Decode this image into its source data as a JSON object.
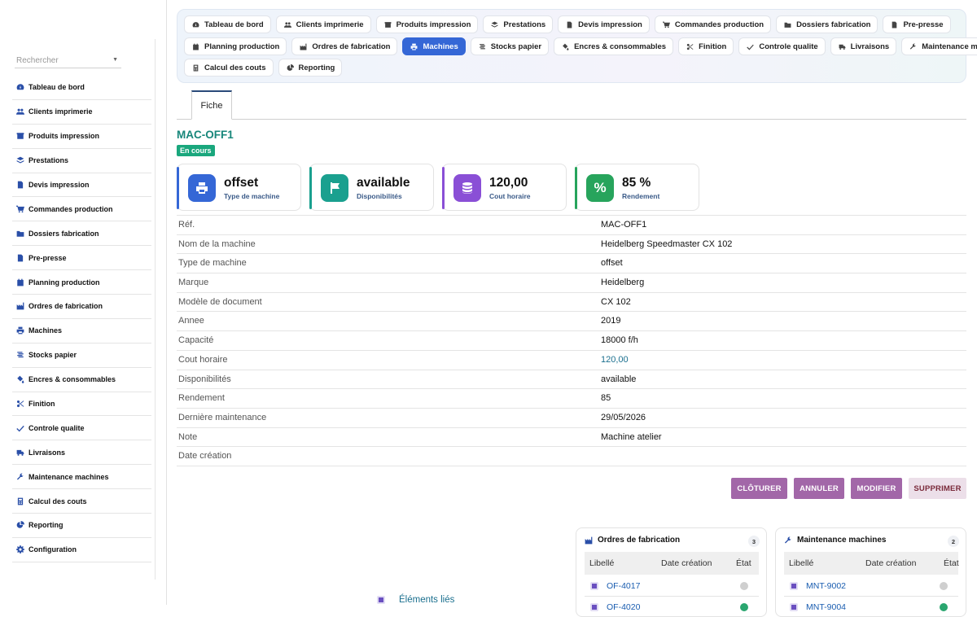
{
  "sidebar": {
    "search_placeholder": "Rechercher",
    "items": [
      {
        "label": "Tableau de bord",
        "icon": "dashboard-icon"
      },
      {
        "label": "Clients imprimerie",
        "icon": "users-icon"
      },
      {
        "label": "Produits impression",
        "icon": "box-icon"
      },
      {
        "label": "Prestations",
        "icon": "layers-icon"
      },
      {
        "label": "Devis impression",
        "icon": "file-icon"
      },
      {
        "label": "Commandes production",
        "icon": "cart-icon"
      },
      {
        "label": "Dossiers fabrication",
        "icon": "folder-icon"
      },
      {
        "label": "Pre-presse",
        "icon": "document-icon"
      },
      {
        "label": "Planning production",
        "icon": "calendar-icon"
      },
      {
        "label": "Ordres de fabrication",
        "icon": "industry-icon"
      },
      {
        "label": "Machines",
        "icon": "printer-icon"
      },
      {
        "label": "Stocks papier",
        "icon": "stack-icon"
      },
      {
        "label": "Encres & consommables",
        "icon": "fill-icon"
      },
      {
        "label": "Finition",
        "icon": "scissors-icon"
      },
      {
        "label": "Controle qualite",
        "icon": "check-icon"
      },
      {
        "label": "Livraisons",
        "icon": "truck-icon"
      },
      {
        "label": "Maintenance machines",
        "icon": "wrench-icon"
      },
      {
        "label": "Calcul des couts",
        "icon": "calculator-icon"
      },
      {
        "label": "Reporting",
        "icon": "chart-pie-icon"
      },
      {
        "label": "Configuration",
        "icon": "gear-icon"
      }
    ]
  },
  "topnav": {
    "row1": [
      "Tableau de bord",
      "Clients imprimerie",
      "Produits impression",
      "Prestations",
      "Devis impression",
      "Commandes production",
      "Dossiers fabrication",
      "Pre-presse"
    ],
    "row2": [
      "Planning production",
      "Ordres de fabrication",
      "Machines",
      "Stocks papier",
      "Encres & consommables",
      "Finition",
      "Controle qualite",
      "Livraisons",
      "Maintenance machines"
    ],
    "row3": [
      "Calcul des couts",
      "Reporting"
    ],
    "active": "Machines"
  },
  "tab": {
    "label": "Fiche"
  },
  "record": {
    "title": "MAC-OFF1",
    "badge": "En cours",
    "badge_color": "#1aa77d"
  },
  "kpis": [
    {
      "value": "offset",
      "label": "Type de machine",
      "color": "#3567d6",
      "icon": "printer-icon"
    },
    {
      "value": "available",
      "label": "Disponibilités",
      "color": "#1aa08f",
      "icon": "flag-icon"
    },
    {
      "value": "120,00",
      "label": "Cout horaire",
      "color": "#8a4fd6",
      "icon": "coins-icon"
    },
    {
      "value": "85 %",
      "label": "Rendement",
      "color": "#27a45c",
      "icon": "percent-icon"
    }
  ],
  "details": [
    {
      "key": "Réf.",
      "value": "MAC-OFF1"
    },
    {
      "key": "Nom de la machine",
      "value": "Heidelberg Speedmaster CX 102"
    },
    {
      "key": "Type de machine",
      "value": "offset"
    },
    {
      "key": "Marque",
      "value": "Heidelberg"
    },
    {
      "key": "Modèle de document",
      "value": "CX 102"
    },
    {
      "key": "Annee",
      "value": "2019"
    },
    {
      "key": "Capacité",
      "value": "18000 f/h"
    },
    {
      "key": "Cout horaire",
      "value": "120,00"
    },
    {
      "key": "Disponibilités",
      "value": "available"
    },
    {
      "key": "Rendement",
      "value": "85"
    },
    {
      "key": "Dernière maintenance",
      "value": "29/05/2026"
    },
    {
      "key": "Note",
      "value": "Machine atelier"
    },
    {
      "key": "Date création",
      "value": ""
    }
  ],
  "actions": {
    "close": "CLÔTURER",
    "cancel": "ANNULER",
    "modify": "MODIFIER",
    "delete": "SUPPRIMER"
  },
  "panels": {
    "orders": {
      "title": "Ordres de fabrication",
      "count": "3",
      "columns": [
        "Libellé",
        "Date création",
        "État"
      ],
      "rows": [
        "OF-4017",
        "OF-4020"
      ]
    },
    "maintenance": {
      "title": "Maintenance machines",
      "count": "2",
      "columns": [
        "Libellé",
        "Date création",
        "État"
      ],
      "rows": [
        "MNT-9002",
        "MNT-9004"
      ]
    }
  },
  "linked": {
    "label": "Éléments liés"
  }
}
